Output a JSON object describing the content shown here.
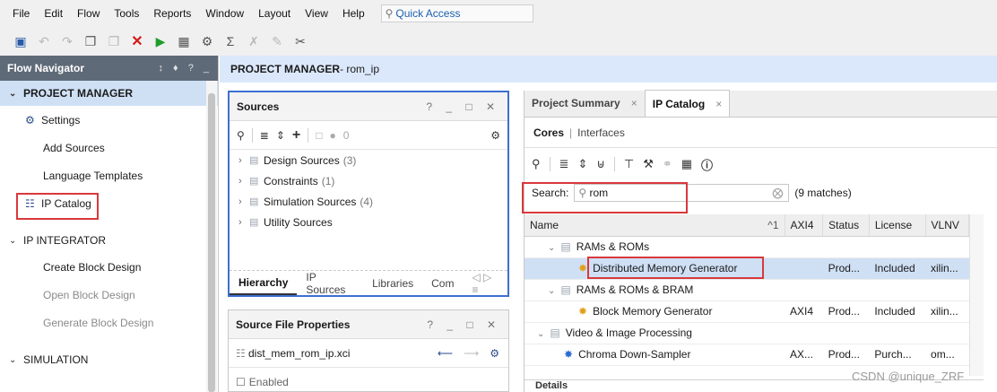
{
  "menu": [
    "File",
    "Edit",
    "Flow",
    "Tools",
    "Reports",
    "Window",
    "Layout",
    "View",
    "Help"
  ],
  "quick_access": {
    "placeholder": "Quick Access"
  },
  "flow_navigator": {
    "title": "Flow Navigator",
    "controls": "↕ ♦ ? _",
    "project_manager": "PROJECT MANAGER",
    "pm_items": [
      "Settings",
      "Add Sources",
      "Language Templates",
      "IP Catalog"
    ],
    "ip_integrator": "IP INTEGRATOR",
    "ii_items": [
      "Create Block Design",
      "Open Block Design",
      "Generate Block Design"
    ],
    "simulation": "SIMULATION"
  },
  "header": {
    "section": "PROJECT MANAGER",
    "project": " - rom_ip"
  },
  "sources": {
    "title": "Sources",
    "controls": "? _ □ ✕",
    "badge": "0",
    "tree": [
      {
        "label": "Design Sources",
        "count": "(3)"
      },
      {
        "label": "Constraints",
        "count": "(1)"
      },
      {
        "label": "Simulation Sources",
        "count": "(4)"
      },
      {
        "label": "Utility Sources",
        "count": ""
      }
    ],
    "tabs": [
      "Hierarchy",
      "IP Sources",
      "Libraries",
      "Com"
    ]
  },
  "source_props": {
    "title": "Source File Properties",
    "controls": "? _ □ ✕",
    "file": "dist_mem_rom_ip.xci",
    "enabled": "Enabled"
  },
  "ip_catalog": {
    "doc_tabs": [
      "Project Summary",
      "IP Catalog"
    ],
    "subtabs": [
      "Cores",
      "Interfaces"
    ],
    "search_label": "Search:",
    "search_value": "rom",
    "matches": "(9 matches)",
    "columns": [
      "Name",
      "AXI4",
      "Status",
      "License",
      "VLNV"
    ],
    "sort_indicator": "^1",
    "rows": [
      {
        "kind": "folder",
        "name": "RAMs & ROMs",
        "axi": "",
        "status": "",
        "license": "",
        "vlnv": ""
      },
      {
        "kind": "ip",
        "name": "Distributed Memory Generator",
        "axi": "",
        "status": "Prod...",
        "license": "Included",
        "vlnv": "xilin..."
      },
      {
        "kind": "folder",
        "name": "RAMs & ROMs & BRAM",
        "axi": "",
        "status": "",
        "license": "",
        "vlnv": ""
      },
      {
        "kind": "ip",
        "name": "Block Memory Generator",
        "axi": "AXI4",
        "status": "Prod...",
        "license": "Included",
        "vlnv": "xilin..."
      },
      {
        "kind": "folder",
        "name": "Video & Image Processing",
        "axi": "",
        "status": "",
        "license": "",
        "vlnv": ""
      },
      {
        "kind": "ip",
        "name": "Chroma Down-Sampler",
        "axi": "AX...",
        "status": "Prod...",
        "license": "Purch...",
        "vlnv": "om..."
      }
    ],
    "details": "Details"
  },
  "watermark": "CSDN @unique_ZRF"
}
